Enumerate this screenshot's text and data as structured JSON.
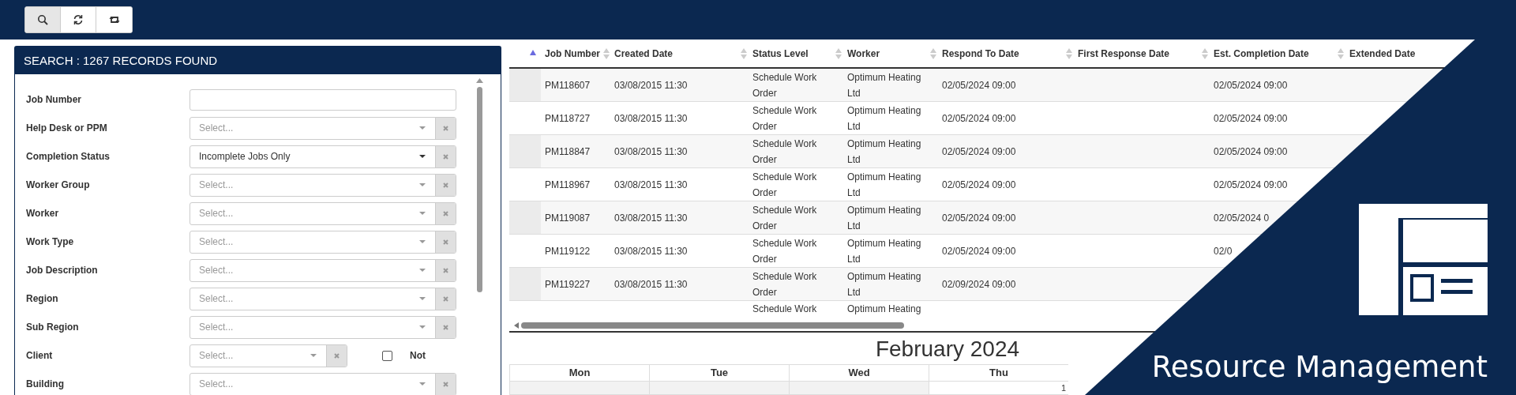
{
  "toolbar": {
    "buttons": [
      {
        "kind": "search",
        "selected": true
      },
      {
        "kind": "refresh",
        "selected": false
      },
      {
        "kind": "repeat",
        "selected": false
      }
    ]
  },
  "search_panel": {
    "title": "SEARCH : 1267 RECORDS FOUND",
    "fields": [
      {
        "kind": "text",
        "label": "Job Number"
      },
      {
        "kind": "select",
        "label": "Help Desk or PPM",
        "placeholder": "Select..."
      },
      {
        "kind": "select",
        "label": "Completion Status",
        "value": "Incomplete Jobs Only"
      },
      {
        "kind": "select",
        "label": "Worker Group",
        "placeholder": "Select..."
      },
      {
        "kind": "select",
        "label": "Worker",
        "placeholder": "Select..."
      },
      {
        "kind": "select",
        "label": "Work Type",
        "placeholder": "Select..."
      },
      {
        "kind": "select",
        "label": "Job Description",
        "placeholder": "Select..."
      },
      {
        "kind": "select",
        "label": "Region",
        "placeholder": "Select..."
      },
      {
        "kind": "select",
        "label": "Sub Region",
        "placeholder": "Select..."
      },
      {
        "kind": "select_not",
        "label": "Client",
        "placeholder": "Select...",
        "not_label": "Not",
        "checked": false
      },
      {
        "kind": "select",
        "label": "Building",
        "placeholder": "Select..."
      }
    ]
  },
  "table": {
    "columns": [
      {
        "label": "Job Number",
        "sorted": true
      },
      {
        "label": "Created Date",
        "sorted": false
      },
      {
        "label": "Status Level",
        "sorted": false
      },
      {
        "label": "Worker",
        "sorted": false
      },
      {
        "label": "Respond To Date",
        "sorted": false
      },
      {
        "label": "First Response Date",
        "sorted": false
      },
      {
        "label": "Est. Completion Date",
        "sorted": false
      },
      {
        "label": "Extended Date",
        "sorted": false
      }
    ],
    "rows": [
      {
        "cells": [
          "PM118607",
          "03/08/2015 11:30",
          "Schedule Work Order",
          "Optimum Heating Ltd",
          "02/05/2024 09:00",
          "",
          "02/05/2024 09:00",
          ""
        ]
      },
      {
        "cells": [
          "PM118727",
          "03/08/2015 11:30",
          "Schedule Work Order",
          "Optimum Heating Ltd",
          "02/05/2024 09:00",
          "",
          "02/05/2024 09:00",
          ""
        ]
      },
      {
        "cells": [
          "PM118847",
          "03/08/2015 11:30",
          "Schedule Work Order",
          "Optimum Heating Ltd",
          "02/05/2024 09:00",
          "",
          "02/05/2024 09:00",
          ""
        ]
      },
      {
        "cells": [
          "PM118967",
          "03/08/2015 11:30",
          "Schedule Work Order",
          "Optimum Heating Ltd",
          "02/05/2024 09:00",
          "",
          "02/05/2024 09:00",
          ""
        ]
      },
      {
        "cells": [
          "PM119087",
          "03/08/2015 11:30",
          "Schedule Work Order",
          "Optimum Heating Ltd",
          "02/05/2024 09:00",
          "",
          "02/05/2024 0",
          ""
        ]
      },
      {
        "cells": [
          "PM119122",
          "03/08/2015 11:30",
          "Schedule Work Order",
          "Optimum Heating Ltd",
          "02/05/2024 09:00",
          "",
          "02/0",
          ""
        ]
      },
      {
        "cells": [
          "PM119227",
          "03/08/2015 11:30",
          "Schedule Work Order",
          "Optimum Heating Ltd",
          "02/09/2024 09:00",
          "",
          "",
          ""
        ]
      },
      {
        "cells": [
          "",
          "",
          "Schedule Work",
          "Optimum Heating",
          "",
          "",
          "",
          ""
        ]
      }
    ]
  },
  "calendar": {
    "title": "February 2024",
    "days": [
      {
        "name": "Mon"
      },
      {
        "name": "Tue"
      },
      {
        "name": "Wed"
      },
      {
        "name": "Thu",
        "first_date": "1"
      }
    ]
  },
  "banner": {
    "title": "Resource Management"
  }
}
